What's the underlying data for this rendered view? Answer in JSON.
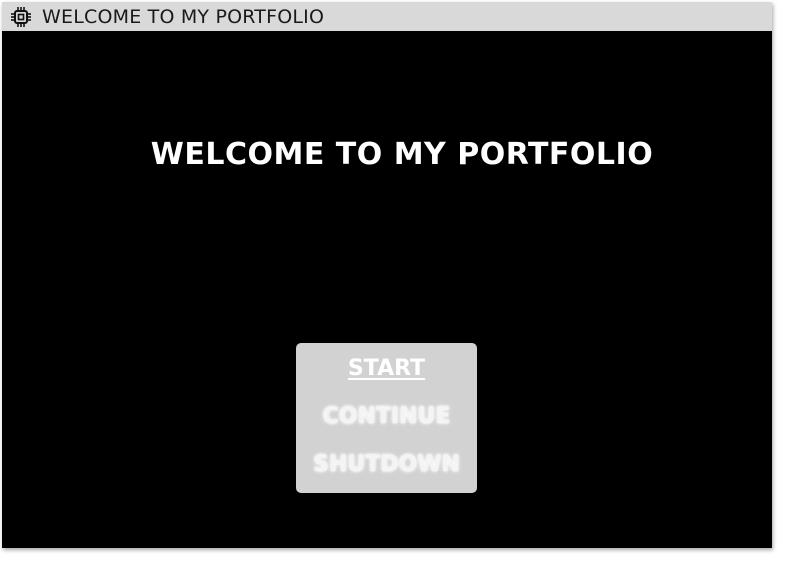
{
  "window": {
    "title": "WELCOME TO MY PORTFOLIO",
    "icon": "chip-icon",
    "titlebar_color": "#d9d9d9",
    "background_color": "#000000"
  },
  "main": {
    "heading": "WELCOME TO MY PORTFOLIO"
  },
  "menu": {
    "background_color": "#d2d2d2",
    "items": [
      {
        "label": "START",
        "state": "selected"
      },
      {
        "label": "CONTINUE",
        "state": "normal"
      },
      {
        "label": "SHUTDOWN",
        "state": "normal"
      }
    ]
  }
}
